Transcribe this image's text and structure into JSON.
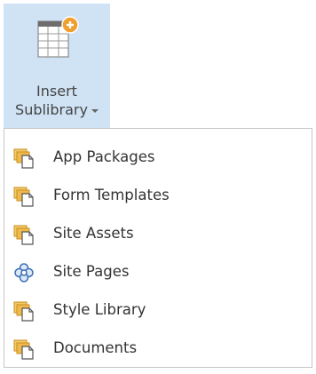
{
  "ribbon_button": {
    "label_line1": "Insert",
    "label_line2": "Sublibrary",
    "icon": "table-add-icon",
    "dropdown_icon": "caret-down-icon"
  },
  "menu": {
    "items": [
      {
        "label": "App Packages",
        "icon": "library-folder-icon"
      },
      {
        "label": "Form Templates",
        "icon": "library-folder-icon"
      },
      {
        "label": "Site Assets",
        "icon": "library-folder-icon"
      },
      {
        "label": "Site Pages",
        "icon": "site-pages-icon"
      },
      {
        "label": "Style Library",
        "icon": "library-folder-icon"
      },
      {
        "label": "Documents",
        "icon": "library-folder-icon"
      }
    ]
  },
  "colors": {
    "button_bg": "#cfe3f5",
    "accent_orange": "#f0a030",
    "folder_gold": "#e8b54a",
    "site_pages_blue": "#3b6fb5",
    "menu_border": "#c6c6c6",
    "text": "#333333"
  }
}
